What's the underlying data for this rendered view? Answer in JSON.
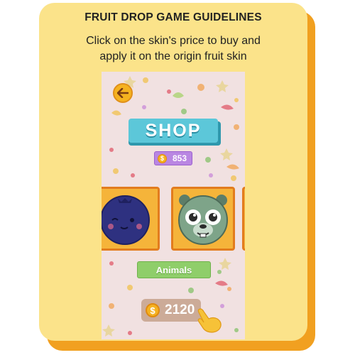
{
  "card": {
    "title": "FRUIT DROP GAME GUIDELINES",
    "subtitle_line1": "Click on the skin's price to buy and",
    "subtitle_line2": "apply it on the origin fruit skin"
  },
  "game": {
    "shop_title": "SHOP",
    "coin_symbol": "$",
    "coin_balance": "853",
    "category_label": "Animals",
    "skin_price": "2120",
    "skins": [
      {
        "name": "blueberry-skin",
        "selected": false
      },
      {
        "name": "bear-skin",
        "selected": true
      }
    ]
  },
  "colors": {
    "card_bg": "#fbe38a",
    "card_shadow": "#f1a020",
    "shop_banner": "#5cc7d9",
    "coin_badge": "#b986e2",
    "category_button": "#8fce6a",
    "price_button": "#ccab98",
    "skin_frame": "#f5b43a"
  },
  "icons": [
    "back-arrow-icon",
    "coin-icon",
    "pointing-hand-icon"
  ]
}
